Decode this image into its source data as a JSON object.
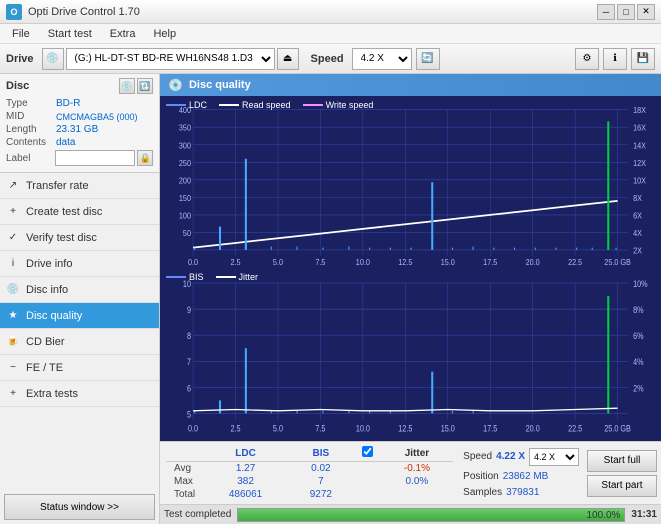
{
  "titleBar": {
    "title": "Opti Drive Control 1.70",
    "icon": "O",
    "controls": [
      "minimize",
      "maximize",
      "close"
    ]
  },
  "menuBar": {
    "items": [
      "File",
      "Start test",
      "Extra",
      "Help"
    ]
  },
  "toolbar": {
    "driveLabel": "Drive",
    "driveValue": "(G:) HL-DT-ST BD-RE  WH16NS48 1.D3",
    "speedLabel": "Speed",
    "speedValue": "4.2 X"
  },
  "discPanel": {
    "title": "Disc",
    "rows": [
      {
        "key": "Type",
        "value": "BD-R",
        "colored": true
      },
      {
        "key": "MID",
        "value": "CMCMAGBA5 (000)",
        "colored": true
      },
      {
        "key": "Length",
        "value": "23.31 GB",
        "colored": true
      },
      {
        "key": "Contents",
        "value": "data",
        "colored": true
      },
      {
        "key": "Label",
        "value": "",
        "colored": false,
        "isInput": true
      }
    ]
  },
  "navItems": [
    {
      "id": "transfer-rate",
      "label": "Transfer rate",
      "icon": "↗"
    },
    {
      "id": "create-test-disc",
      "label": "Create test disc",
      "icon": "+"
    },
    {
      "id": "verify-test-disc",
      "label": "Verify test disc",
      "icon": "✓"
    },
    {
      "id": "drive-info",
      "label": "Drive info",
      "icon": "i"
    },
    {
      "id": "disc-info",
      "label": "Disc info",
      "icon": "💿"
    },
    {
      "id": "disc-quality",
      "label": "Disc quality",
      "icon": "★",
      "active": true
    },
    {
      "id": "cd-bier",
      "label": "CD Bier",
      "icon": "🍺"
    },
    {
      "id": "fe-te",
      "label": "FE / TE",
      "icon": "~"
    },
    {
      "id": "extra-tests",
      "label": "Extra tests",
      "icon": "+"
    }
  ],
  "statusWindow": {
    "label": "Status window >>"
  },
  "discQuality": {
    "title": "Disc quality",
    "legend": {
      "ldc": "LDC",
      "readSpeed": "Read speed",
      "writeSpeed": "Write speed",
      "bis": "BIS",
      "jitter": "Jitter"
    },
    "chart1": {
      "yAxisMax": 400,
      "yAxisMin": 0,
      "yRight": [
        "18X",
        "16X",
        "14X",
        "12X",
        "10X",
        "8X",
        "6X",
        "4X",
        "2X"
      ],
      "xAxisMax": 25.0,
      "label": "LDC"
    },
    "chart2": {
      "yAxisMax": 10,
      "yAxisMin": 0,
      "yRight": [
        "10%",
        "8%",
        "6%",
        "4%",
        "2%"
      ],
      "xAxisMax": 25.0,
      "label": "BIS/Jitter"
    }
  },
  "statsTable": {
    "headers": [
      "LDC",
      "BIS",
      "",
      "Jitter",
      "Speed",
      ""
    ],
    "rows": [
      {
        "label": "Avg",
        "ldc": "1.27",
        "bis": "0.02",
        "jitter": "-0.1%",
        "speed_label": "Position",
        "speed_val": "23862 MB"
      },
      {
        "label": "Max",
        "ldc": "382",
        "bis": "7",
        "jitter": "0.0%",
        "speed_label": "Samples",
        "speed_val": "379831"
      },
      {
        "label": "Total",
        "ldc": "486061",
        "bis": "9272",
        "jitter": "",
        "speed_label": "",
        "speed_val": ""
      }
    ],
    "speedCurrent": "4.22 X",
    "speedDropdown": "4.2 X",
    "jitterChecked": true
  },
  "buttons": {
    "startFull": "Start full",
    "startPart": "Start part"
  },
  "progress": {
    "statusText": "Test completed",
    "percentage": "100.0%",
    "fillWidth": 100,
    "time": "31:31"
  }
}
